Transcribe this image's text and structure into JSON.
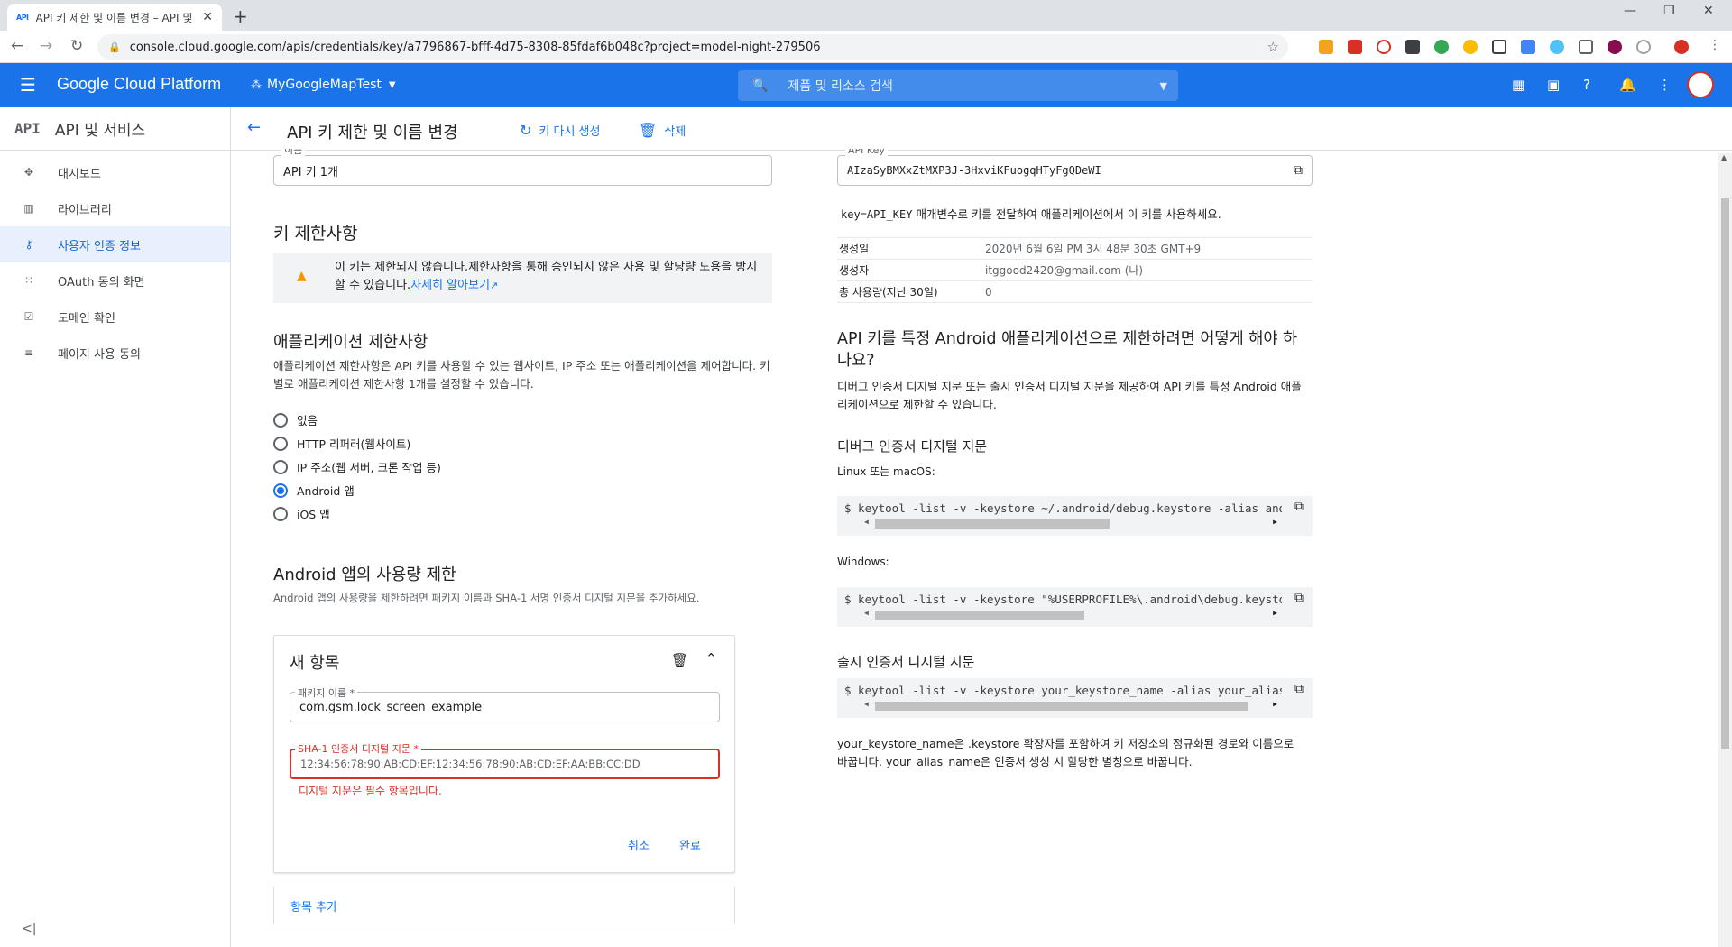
{
  "browser": {
    "tab_title": "API 키 제한 및 이름 변경 – API 및",
    "tab_favicon": "API",
    "url": "console.cloud.google.com/apis/credentials/key/a7796867-bfff-4d75-8308-85fdaf6b048c?project=model-night-279506"
  },
  "header": {
    "title": "Google Cloud Platform",
    "project": "MyGoogleMapTest",
    "search_placeholder": "제품 및 리소스 검색"
  },
  "sidebar": {
    "logo": "API",
    "title": "API 및 서비스",
    "items": [
      {
        "label": "대시보드",
        "icon": "dashboard-icon"
      },
      {
        "label": "라이브러리",
        "icon": "library-icon"
      },
      {
        "label": "사용자 인증 정보",
        "icon": "key-icon",
        "active": true
      },
      {
        "label": "OAuth 동의 화면",
        "icon": "oauth-icon"
      },
      {
        "label": "도메인 확인",
        "icon": "domain-check-icon"
      },
      {
        "label": "페이지 사용 동의",
        "icon": "page-consent-icon"
      }
    ],
    "collapse_label": "<|"
  },
  "page": {
    "title": "API 키 제한 및 이름 변경",
    "regenerate_label": "키 다시 생성",
    "delete_label": "삭제"
  },
  "left": {
    "name_label": "이름",
    "name_value": "API 키 1개",
    "key_restrictions_heading": "키 제한사항",
    "warning_text": "이 키는 제한되지 않습니다.제한사항을 통해 승인되지 않은 사용 및 할당량 도용을 방지할 수 있습니다.",
    "warning_link": "자세히 알아보기",
    "app_restrictions_heading": "애플리케이션 제한사항",
    "app_restrictions_desc": "애플리케이션 제한사항은 API 키를 사용할 수 있는 웹사이트, IP 주소 또는 애플리케이션을 제어합니다. 키별로 애플리케이션 제한사항 1개를 설정할 수 있습니다.",
    "radios": [
      {
        "label": "없음",
        "checked": false
      },
      {
        "label": "HTTP 리퍼러(웹사이트)",
        "checked": false
      },
      {
        "label": "IP 주소(웹 서버, 크론 작업 등)",
        "checked": false
      },
      {
        "label": "Android 앱",
        "checked": true
      },
      {
        "label": "iOS 앱",
        "checked": false
      }
    ],
    "android_heading": "Android 앱의 사용량 제한",
    "android_desc": "Android 앱의 사용량을 제한하려면 패키지 이름과 SHA-1 서명 인증서 디지털 지문을 추가하세요.",
    "new_item": {
      "title": "새 항목",
      "package_label": "패키지 이름 *",
      "package_value": "com.gsm.lock_screen_example",
      "sha_label": "SHA-1 인증서 디지털 지문 *",
      "sha_placeholder": "12:34:56:78:90:AB:CD:EF:12:34:56:78:90:AB:CD:EF:AA:BB:CC:DD",
      "error": "디지털 지문은 필수 항목입니다.",
      "cancel_label": "취소",
      "done_label": "완료"
    },
    "add_item_label": "항목 추가"
  },
  "right": {
    "key_label": "API Key",
    "key_value": "AIzaSyBMXxZtMXP3J-3HxviKFuogqHTyFgQDeWI",
    "usage_param": "key=API_KEY",
    "usage_text": " 매개변수로 키를 전달하여 애플리케이션에서 이 키를 사용하세요.",
    "meta": [
      {
        "k": "생성일",
        "v": "2020년 6월 6일 PM 3시 48분 30초 GMT+9"
      },
      {
        "k": "생성자",
        "v": "itggood2420@gmail.com (나)"
      },
      {
        "k": "총 사용량(지난 30일)",
        "v": "0"
      }
    ],
    "android_q_heading": "API 키를 특정 Android 애플리케이션으로 제한하려면 어떻게 해야 하나요?",
    "android_q_desc": "디버그 인증서 디지털 지문 또는 출시 인증서 디지털 지문을 제공하여 API 키를 특정 Android 애플리케이션으로 제한할 수 있습니다.",
    "debug_heading": "디버그 인증서 디지털 지문",
    "linux_label": "Linux 또는 macOS:",
    "linux_cmd": "$ keytool -list -v -keystore ~/.android/debug.keystore -alias androi",
    "windows_label": "Windows:",
    "windows_cmd": "$ keytool -list -v -keystore \"%USERPROFILE%\\.android\\debug.keystore\"",
    "release_heading": "출시 인증서 디지털 지문",
    "release_cmd": "$ keytool -list -v -keystore your_keystore_name -alias your_alias_na",
    "release_note": "your_keystore_name은 .keystore 확장자를 포함하여 키 저장소의 정규화된 경로와 이름으로 바꿉니다. your_alias_name은 인증서 생성 시 할당한 별칭으로 바꿉니다."
  }
}
